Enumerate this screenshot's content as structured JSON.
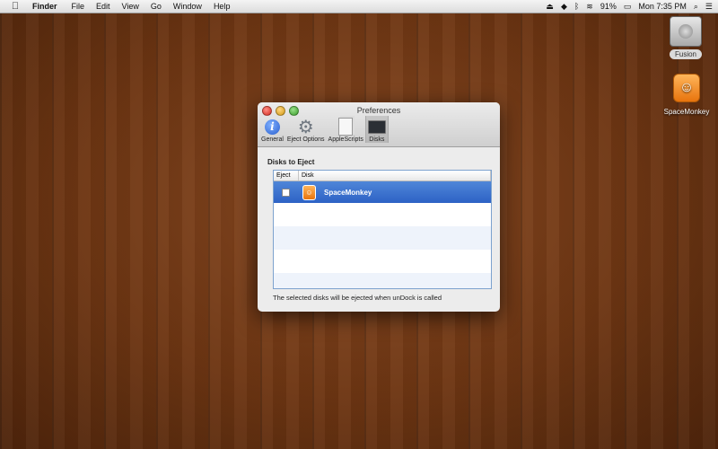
{
  "menubar": {
    "apple": "",
    "app": "Finder",
    "menus": [
      "File",
      "Edit",
      "View",
      "Go",
      "Window",
      "Help"
    ],
    "battery": "91%",
    "clock": "Mon 7:35 PM"
  },
  "desktop": {
    "icons": [
      {
        "label": "Fusion",
        "icon": "hard-drive-icon"
      },
      {
        "label": "SpaceMonkey",
        "icon": "spacemonkey-icon"
      }
    ]
  },
  "window": {
    "title": "Preferences",
    "toolbar": [
      {
        "label": "General",
        "icon": "info-icon"
      },
      {
        "label": "Eject Options",
        "icon": "gear-icon"
      },
      {
        "label": "AppleScripts",
        "icon": "script-icon"
      },
      {
        "label": "Disks",
        "icon": "disk-icon",
        "selected": true
      }
    ],
    "section_title": "Disks to Eject",
    "table": {
      "columns": [
        "Eject",
        "Disk"
      ],
      "rows": [
        {
          "eject": false,
          "disk": "SpaceMonkey",
          "selected": true
        }
      ]
    },
    "note": "The selected disks will be ejected when unDock is called"
  },
  "colors": {
    "selection": "#3b6fcd",
    "desktop_wood": "#6e3613"
  }
}
